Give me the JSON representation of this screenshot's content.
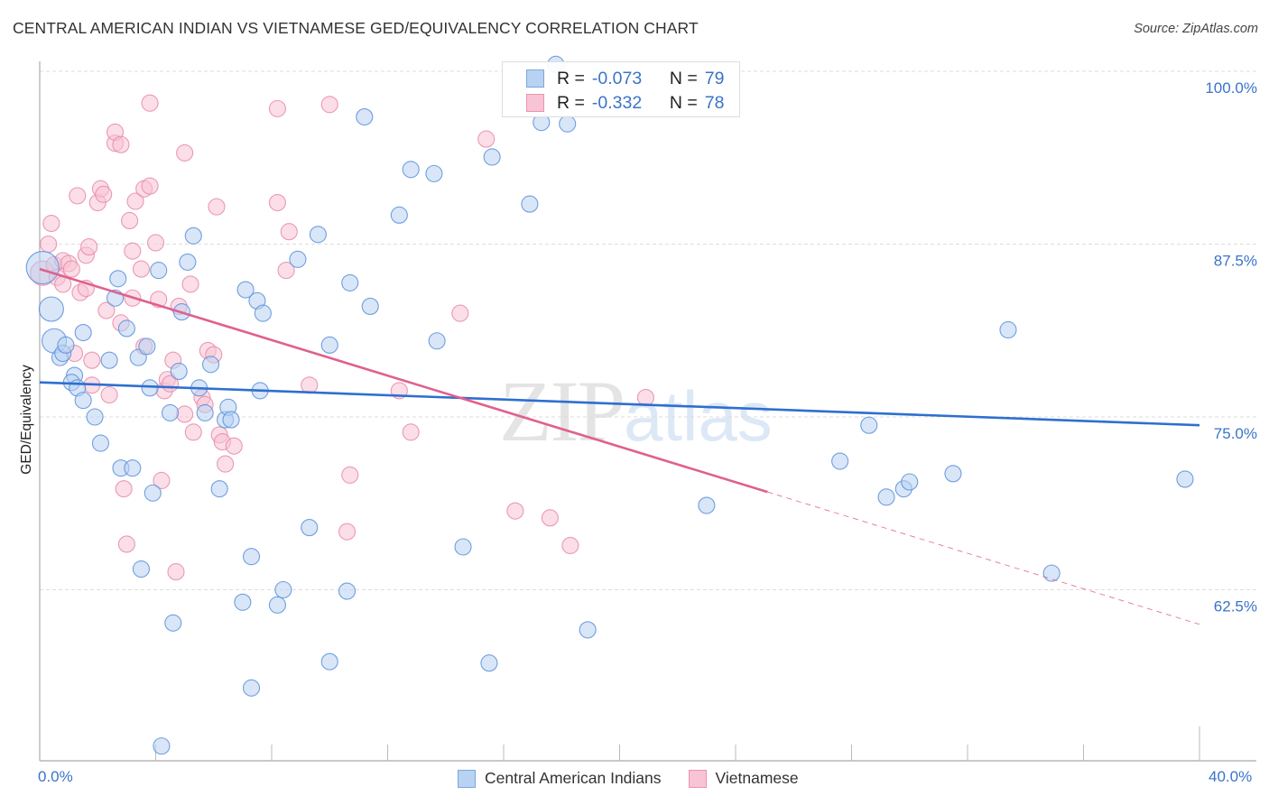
{
  "header": {
    "title": "CENTRAL AMERICAN INDIAN VS VIETNAMESE GED/EQUIVALENCY CORRELATION CHART",
    "source": "Source: ZipAtlas.com"
  },
  "watermark": {
    "zip": "ZIP",
    "atlas": "atlas"
  },
  "colors": {
    "blue_fill": "#b8d2f2",
    "blue_stroke": "#5b8fd9",
    "blue_line": "#2e6fd0",
    "pink_fill": "#f8c3d4",
    "pink_stroke": "#e889a8",
    "pink_line": "#e0608f",
    "axis_text": "#3a74c8",
    "grid": "#dddddd"
  },
  "legend": {
    "rows": [
      {
        "r_label": "R =",
        "r_value": "-0.073",
        "n_label": "N =",
        "n_value": "79"
      },
      {
        "r_label": "R =",
        "r_value": "-0.332",
        "n_label": "N =",
        "n_value": "78"
      }
    ]
  },
  "chart_data": {
    "type": "scatter",
    "title": "CENTRAL AMERICAN INDIAN VS VIETNAMESE GED/EQUIVALENCY CORRELATION CHART",
    "xlabel": "",
    "ylabel": "GED/Equivalency",
    "xlim": [
      0,
      40
    ],
    "ylim": [
      52,
      101.5
    ],
    "x_tick_labels": [
      "0.0%",
      "40.0%"
    ],
    "y_ticks": [
      100,
      87.5,
      75,
      62.5
    ],
    "y_tick_labels": [
      "100.0%",
      "87.5%",
      "75.0%",
      "62.5%"
    ],
    "x_minor_ticks": [
      4,
      8,
      12,
      16,
      20,
      24,
      28,
      32,
      36,
      40
    ],
    "grid": true,
    "legend_position": "bottom",
    "series": [
      {
        "name": "Central American Indians",
        "r": -0.073,
        "n": 79,
        "trend": {
          "x": [
            0,
            40
          ],
          "y": [
            77.5,
            74.4
          ],
          "solid_until": 40
        },
        "points": [
          [
            0.1,
            85.8,
            2
          ],
          [
            0.4,
            82.8,
            1.5
          ],
          [
            0.5,
            80.5,
            1.5
          ],
          [
            0.7,
            79.3
          ],
          [
            0.8,
            79.6
          ],
          [
            0.9,
            80.2
          ],
          [
            1.2,
            78.0
          ],
          [
            1.1,
            77.5
          ],
          [
            1.3,
            77.1
          ],
          [
            1.5,
            76.2
          ],
          [
            1.5,
            81.1
          ],
          [
            1.9,
            75.0
          ],
          [
            2.1,
            73.1
          ],
          [
            2.4,
            79.1
          ],
          [
            2.6,
            83.6
          ],
          [
            2.7,
            85.0
          ],
          [
            2.8,
            71.3
          ],
          [
            3.0,
            81.4
          ],
          [
            3.2,
            71.3
          ],
          [
            3.4,
            79.3
          ],
          [
            3.5,
            64.0
          ],
          [
            3.7,
            80.1
          ],
          [
            3.8,
            77.1
          ],
          [
            3.9,
            69.5
          ],
          [
            4.1,
            85.6
          ],
          [
            4.2,
            51.2
          ],
          [
            4.5,
            75.3
          ],
          [
            4.6,
            60.1
          ],
          [
            4.8,
            78.3
          ],
          [
            4.9,
            82.6
          ],
          [
            5.1,
            86.2
          ],
          [
            5.3,
            88.1
          ],
          [
            5.5,
            77.1
          ],
          [
            5.7,
            75.3
          ],
          [
            5.9,
            78.8
          ],
          [
            6.2,
            69.8
          ],
          [
            6.4,
            74.8
          ],
          [
            6.5,
            75.7
          ],
          [
            6.6,
            74.8
          ],
          [
            7.1,
            84.2
          ],
          [
            7.3,
            55.4
          ],
          [
            7.0,
            61.6
          ],
          [
            7.5,
            83.4
          ],
          [
            7.6,
            76.9
          ],
          [
            7.7,
            82.5
          ],
          [
            7.3,
            64.9
          ],
          [
            8.2,
            61.4
          ],
          [
            8.4,
            62.5
          ],
          [
            8.9,
            86.4
          ],
          [
            9.3,
            67.0
          ],
          [
            9.6,
            88.2
          ],
          [
            10.0,
            80.2
          ],
          [
            10.0,
            57.3
          ],
          [
            10.6,
            62.4
          ],
          [
            10.7,
            84.7
          ],
          [
            11.2,
            96.7
          ],
          [
            11.4,
            83.0
          ],
          [
            12.4,
            89.6
          ],
          [
            12.8,
            92.9
          ],
          [
            13.6,
            92.6
          ],
          [
            13.7,
            80.5
          ],
          [
            14.6,
            65.6
          ],
          [
            15.5,
            57.2
          ],
          [
            15.6,
            93.8
          ],
          [
            16.9,
            90.4
          ],
          [
            17.3,
            96.3
          ],
          [
            18.2,
            96.2
          ],
          [
            18.9,
            59.6
          ],
          [
            17.8,
            100.5
          ],
          [
            23.0,
            68.6
          ],
          [
            27.6,
            71.8
          ],
          [
            28.6,
            74.4
          ],
          [
            29.2,
            69.2
          ],
          [
            29.8,
            69.8
          ],
          [
            30.0,
            70.3
          ],
          [
            31.5,
            70.9
          ],
          [
            33.4,
            81.3
          ],
          [
            34.9,
            63.7
          ],
          [
            39.5,
            70.5
          ]
        ]
      },
      {
        "name": "Vietnamese",
        "r": -0.332,
        "n": 78,
        "trend": {
          "x": [
            0,
            40
          ],
          "y": [
            85.7,
            60.0
          ],
          "solid_until": 25.1
        },
        "points": [
          [
            0.1,
            85.4,
            1.5
          ],
          [
            0.3,
            87.5
          ],
          [
            0.4,
            89.0
          ],
          [
            0.5,
            86.0
          ],
          [
            0.6,
            85.1
          ],
          [
            0.8,
            84.6
          ],
          [
            0.8,
            86.3
          ],
          [
            1.0,
            86.1
          ],
          [
            1.1,
            85.7
          ],
          [
            1.2,
            79.6
          ],
          [
            1.3,
            91.0
          ],
          [
            1.4,
            84.0
          ],
          [
            1.6,
            84.3
          ],
          [
            1.6,
            86.7
          ],
          [
            1.7,
            87.3
          ],
          [
            1.8,
            77.3
          ],
          [
            1.8,
            79.1
          ],
          [
            2.0,
            90.5
          ],
          [
            2.1,
            91.5
          ],
          [
            2.2,
            91.1
          ],
          [
            2.3,
            82.7
          ],
          [
            2.4,
            76.6
          ],
          [
            2.6,
            94.8
          ],
          [
            2.6,
            95.6
          ],
          [
            2.8,
            94.7
          ],
          [
            2.8,
            81.8
          ],
          [
            2.9,
            69.8
          ],
          [
            3.0,
            65.8
          ],
          [
            3.1,
            89.2
          ],
          [
            3.2,
            87.0
          ],
          [
            3.2,
            83.6
          ],
          [
            3.3,
            90.6
          ],
          [
            3.5,
            85.7
          ],
          [
            3.6,
            80.1
          ],
          [
            3.6,
            91.5
          ],
          [
            3.8,
            91.7
          ],
          [
            3.8,
            97.7
          ],
          [
            4.0,
            87.6
          ],
          [
            4.1,
            83.5
          ],
          [
            4.2,
            70.4
          ],
          [
            4.3,
            76.9
          ],
          [
            4.4,
            77.7
          ],
          [
            4.5,
            77.4
          ],
          [
            4.6,
            79.1
          ],
          [
            4.7,
            63.8
          ],
          [
            4.8,
            83.0
          ],
          [
            5.0,
            94.1
          ],
          [
            5.0,
            75.2
          ],
          [
            5.2,
            84.6
          ],
          [
            5.3,
            73.9
          ],
          [
            5.6,
            76.4
          ],
          [
            5.7,
            75.9
          ],
          [
            5.8,
            79.8
          ],
          [
            6.0,
            79.5
          ],
          [
            6.1,
            90.2
          ],
          [
            6.2,
            73.7
          ],
          [
            6.3,
            73.2
          ],
          [
            6.4,
            71.6
          ],
          [
            6.7,
            72.9
          ],
          [
            8.2,
            97.3
          ],
          [
            8.2,
            90.5
          ],
          [
            8.5,
            85.6
          ],
          [
            8.6,
            88.4
          ],
          [
            9.3,
            77.3
          ],
          [
            10.0,
            97.6
          ],
          [
            10.7,
            70.8
          ],
          [
            10.6,
            66.7
          ],
          [
            12.4,
            76.9
          ],
          [
            12.8,
            73.9
          ],
          [
            14.5,
            82.5
          ],
          [
            15.4,
            95.1
          ],
          [
            16.4,
            68.2
          ],
          [
            17.6,
            67.7
          ],
          [
            18.3,
            65.7
          ],
          [
            20.9,
            76.4
          ]
        ]
      }
    ]
  },
  "bottom_legend": {
    "items": [
      {
        "label": "Central American Indians"
      },
      {
        "label": "Vietnamese"
      }
    ]
  },
  "axis": {
    "y_label": "GED/Equivalency",
    "x_min_label": "0.0%",
    "x_max_label": "40.0%"
  }
}
